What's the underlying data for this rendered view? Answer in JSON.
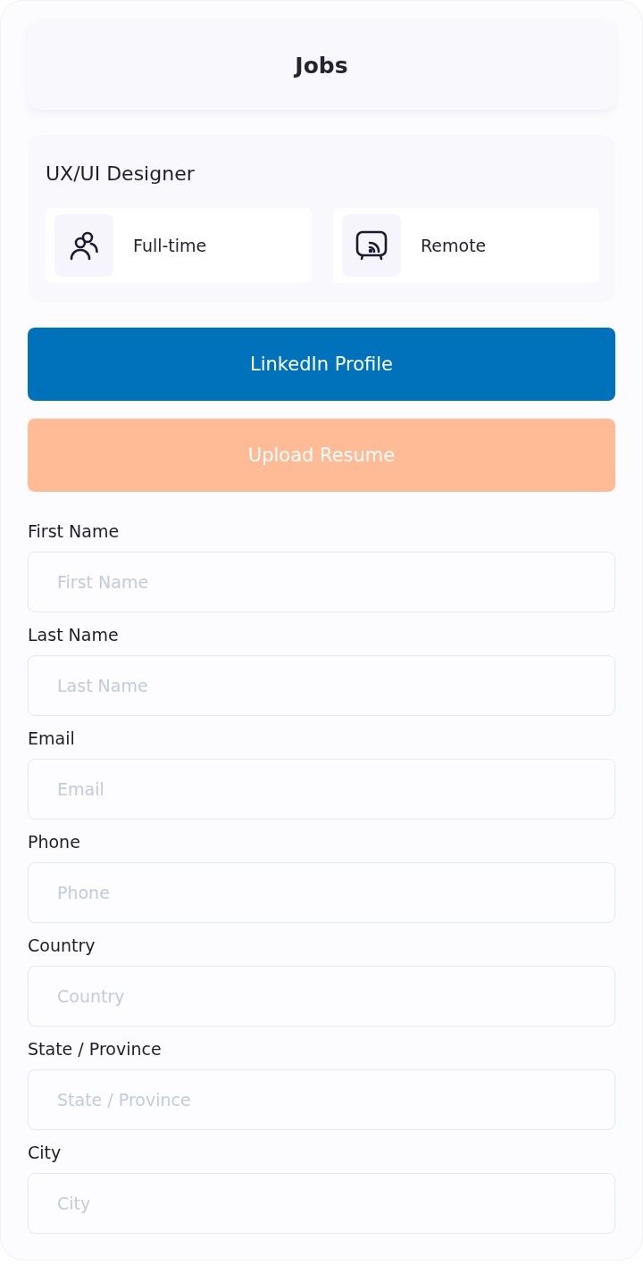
{
  "header": {
    "title": "Jobs"
  },
  "job": {
    "title": "UX/UI Designer",
    "tags": [
      {
        "kind": "employment",
        "label": "Full-time"
      },
      {
        "kind": "location",
        "label": "Remote"
      }
    ]
  },
  "buttons": [
    {
      "kind": "linkedin",
      "label": "LinkedIn Profile"
    },
    {
      "kind": "upload",
      "label": "Upload Resume"
    }
  ],
  "form": {
    "fields": [
      {
        "label": "First Name",
        "placeholder": "First Name"
      },
      {
        "label": "Last Name",
        "placeholder": "Last Name"
      },
      {
        "label": "Email",
        "placeholder": "Email"
      },
      {
        "label": "Phone",
        "placeholder": "Phone"
      },
      {
        "label": "Country",
        "placeholder": "Country"
      },
      {
        "label": "State / Province",
        "placeholder": "State / Province"
      },
      {
        "label": "City",
        "placeholder": "City"
      }
    ]
  }
}
